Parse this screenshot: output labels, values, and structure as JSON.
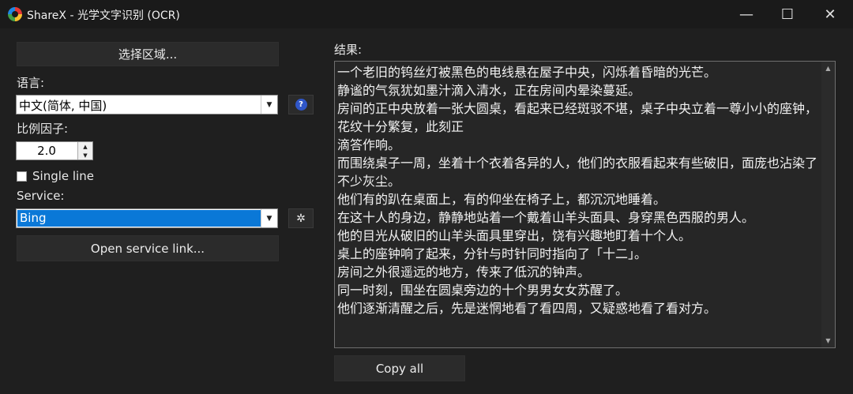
{
  "window": {
    "title": "ShareX - 光学文字识别 (OCR)",
    "minimize_glyph": "—",
    "maximize_glyph": "☐",
    "close_glyph": "✕"
  },
  "left": {
    "select_region_label": "选择区域...",
    "language_label": "语言:",
    "language_value": "中文(简体, 中国)",
    "scale_label": "比例因子:",
    "scale_value": "2.0",
    "single_line_label": "Single line",
    "single_line_checked": false,
    "service_label": "Service:",
    "service_value": "Bing",
    "open_service_link_label": "Open service link..."
  },
  "right": {
    "result_label": "结果:",
    "result_text": "一个老旧的钨丝灯被黑色的电线悬在屋子中央，闪烁着昏暗的光芒。\n静谧的气氛犹如墨汁滴入清水，正在房间内晕染蔓延。\n房间的正中央放着一张大圆桌，看起来已经斑驳不堪，桌子中央立着一尊小小的座钟，花纹十分繁复，此刻正\n滴答作响。\n而围绕桌子一周，坐着十个衣着各异的人，他们的衣服看起来有些破旧，面庞也沾染了不少灰尘。\n他们有的趴在桌面上，有的仰坐在椅子上，都沉沉地睡着。\n在这十人的身边，静静地站着一个戴着山羊头面具、身穿黑色西服的男人。\n他的目光从破旧的山羊头面具里穿出，饶有兴趣地盯着十个人。\n桌上的座钟响了起来，分针与时针同时指向了「十二」。\n房间之外很遥远的地方，传来了低沉的钟声。\n同一时刻，围坐在圆桌旁边的十个男男女女苏醒了。\n他们逐渐清醒之后，先是迷惘地看了看四周，又疑惑地看了看对方。",
    "copy_all_label": "Copy all"
  },
  "icons": {
    "help": "?",
    "gear": "✲",
    "dropdown": "▼",
    "spin_up": "▲",
    "spin_down": "▼",
    "scroll_up": "▲",
    "scroll_down": "▼"
  },
  "colors": {
    "background": "#1f1f1f",
    "selection": "#0a78d7",
    "help_icon": "#2f56c8"
  }
}
